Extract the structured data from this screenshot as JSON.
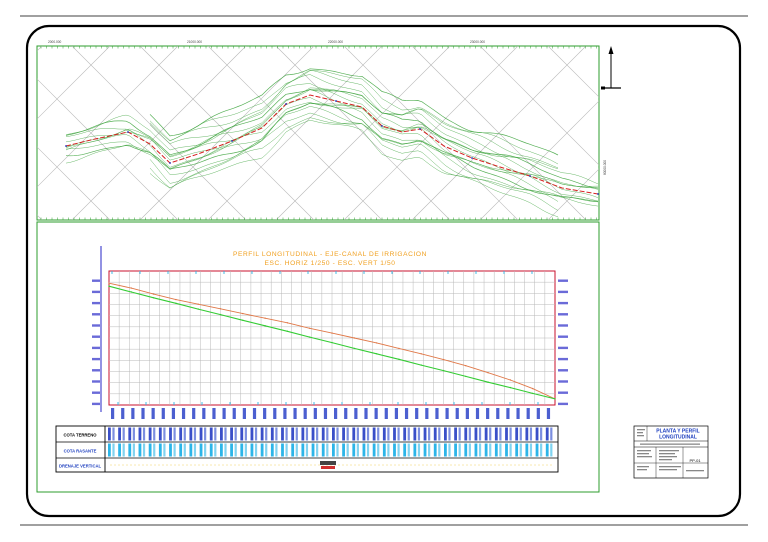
{
  "colors": {
    "frame": "#000000",
    "panel_border": "#2e9d2e",
    "grid": "#b8b8b8",
    "contour": "#3aa23a",
    "axis_line": "#4a4ad0",
    "profile_box": "#c8102e",
    "terrain": "#e07848",
    "grade": "#33cc33",
    "title": "#f0a020",
    "label_blue": "#1e3fbf",
    "cyan": "#2cb5e8"
  },
  "plan": {
    "top_coords": [
      "2000.000",
      "21000.000",
      "22000.000",
      "23000.000"
    ],
    "bottom_coords": [
      "4000.000",
      "5000.000",
      "6000.000",
      "7000.000"
    ],
    "side_coord": "80000.000"
  },
  "profile": {
    "title": "PERFIL LONGITUDINAL - EJE-CANAL DE IRRIGACION",
    "subtitle": "ESC. HORIZ 1/250 - ESC. VERT 1/50"
  },
  "guitar": {
    "row1": "COTA TERRENO",
    "row2": "COTA RASANTE",
    "row3": "DRENAJE VERTICAL"
  },
  "titleblock": {
    "line1": "PLANTA Y PERFIL",
    "line2": "LONGITUDINAL",
    "sheet": "PP-01"
  },
  "chart_data": {
    "type": "line",
    "x": [
      0,
      5,
      10,
      15,
      20,
      25,
      30,
      35,
      40,
      45,
      50,
      55,
      60,
      65,
      70,
      75,
      80,
      85,
      90,
      95,
      100
    ],
    "series": [
      {
        "values": [
          100,
          98.4,
          96.4,
          94.6,
          93.1,
          91.6,
          90.0,
          88.5,
          87.0,
          85.2,
          83.6,
          82.0,
          80.4,
          78.6,
          76.8,
          74.9,
          72.9,
          70.6,
          68.2,
          65.4,
          62.0
        ]
      },
      {
        "values": [
          99.0,
          97.1,
          95.2,
          93.4,
          91.5,
          89.7,
          87.8,
          86.0,
          84.2,
          82.3,
          80.5,
          78.6,
          76.8,
          75.0,
          73.1,
          71.3,
          69.4,
          67.5,
          65.7,
          63.8,
          62.0
        ]
      }
    ],
    "ylim": [
      60,
      104
    ],
    "xlim": [
      0,
      100
    ],
    "grid": true
  }
}
